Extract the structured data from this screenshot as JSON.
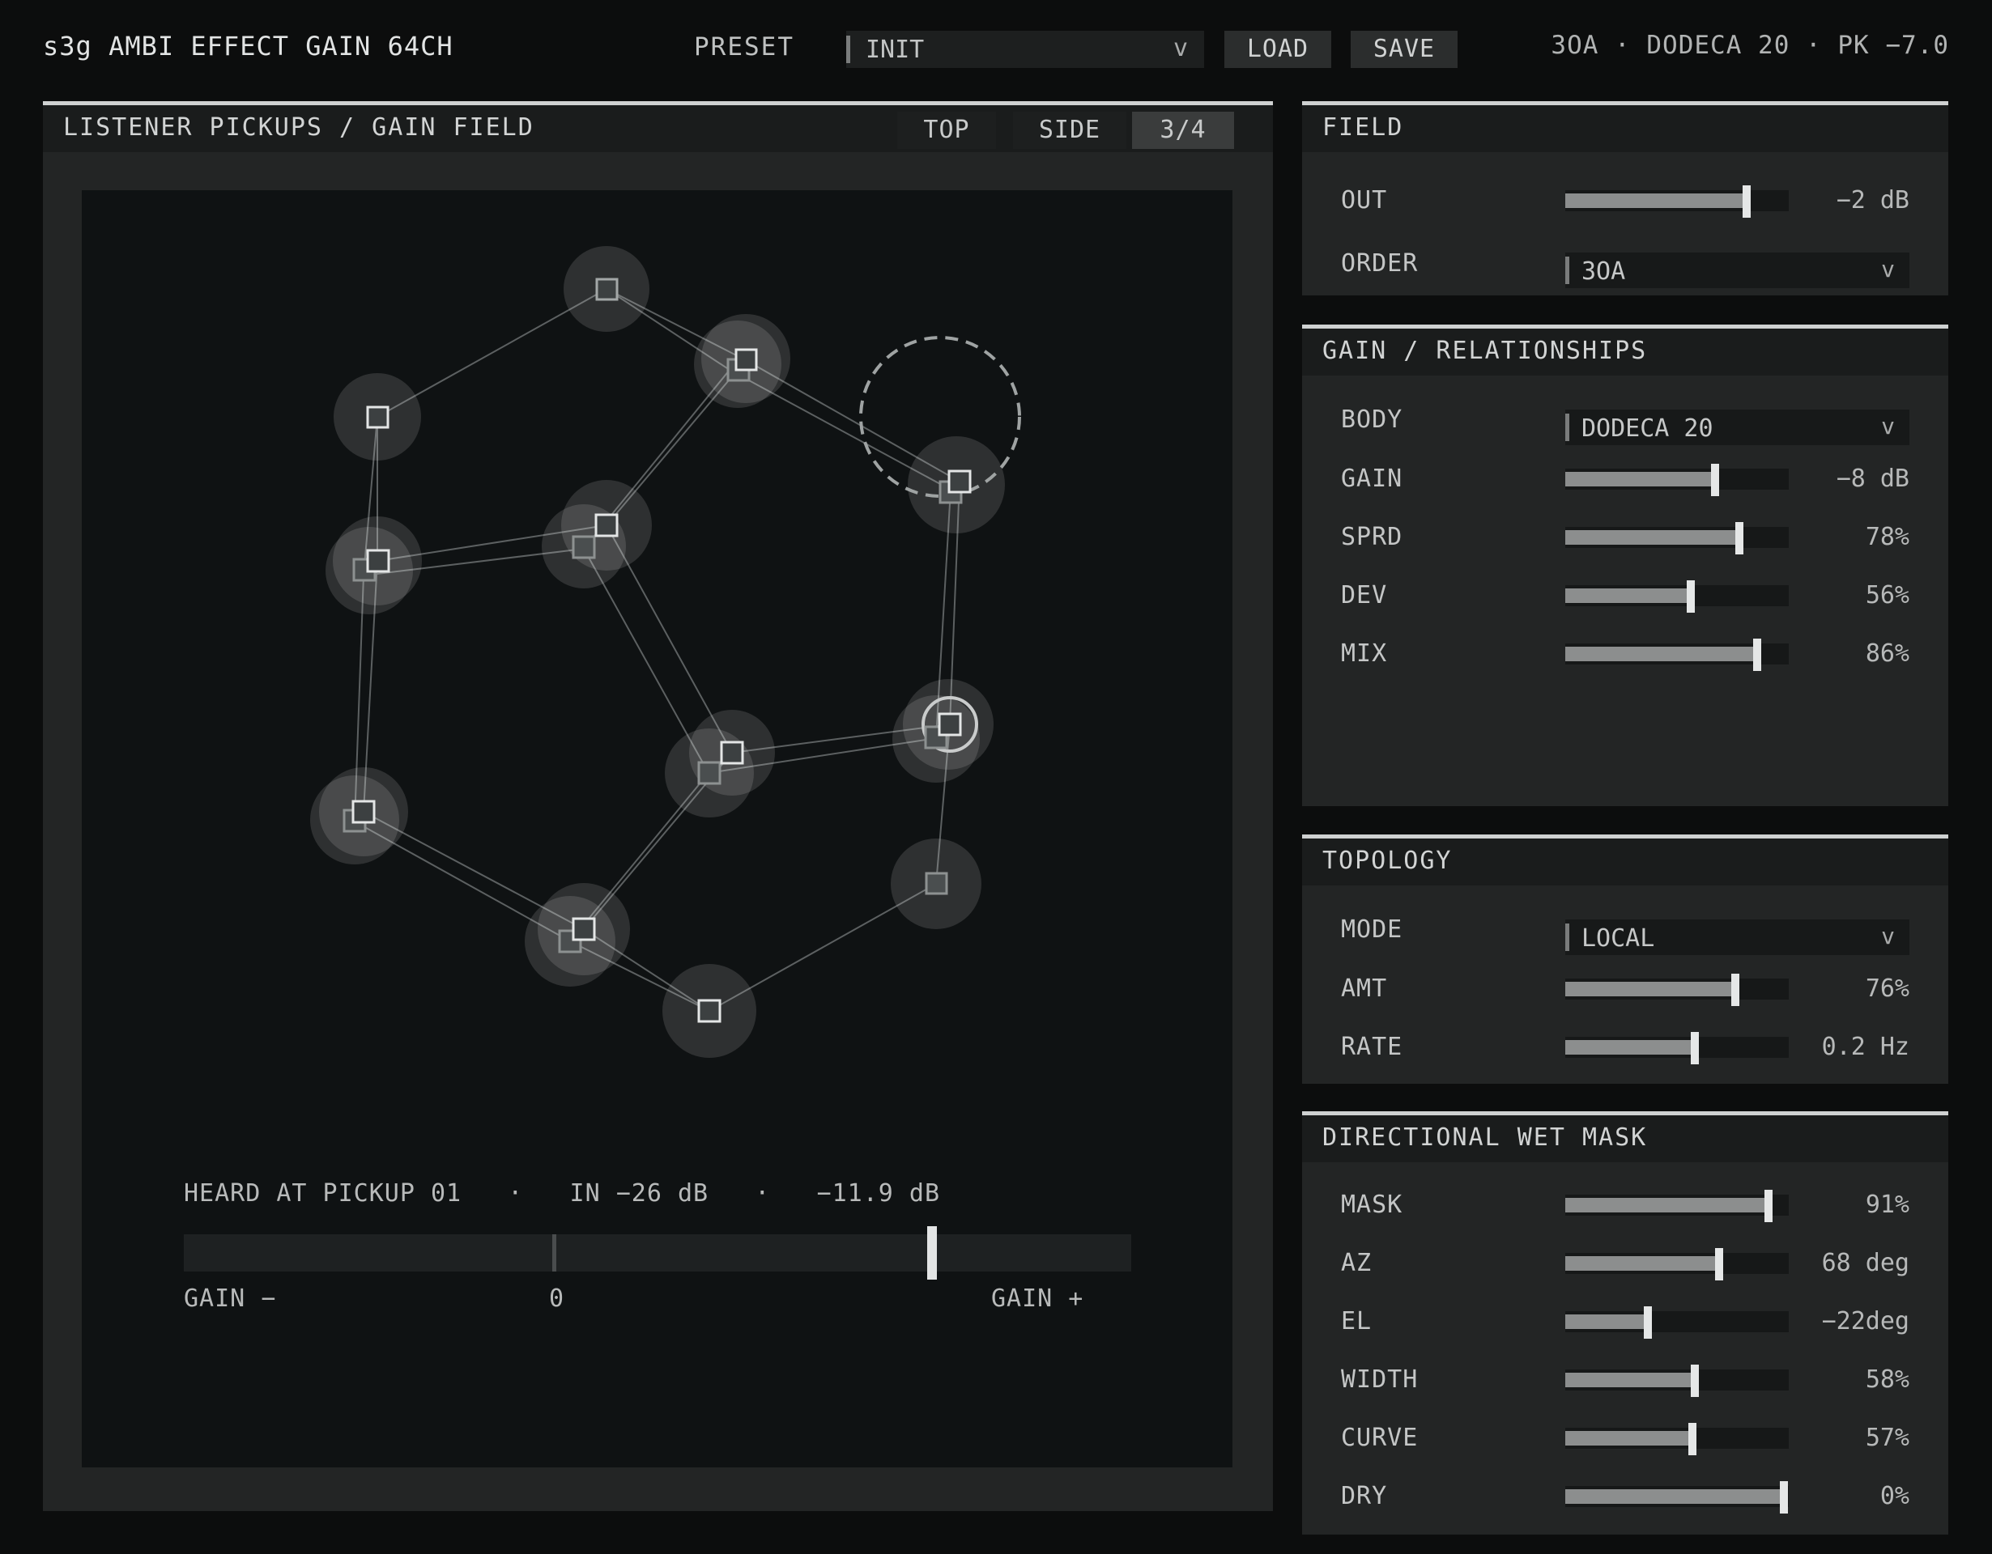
{
  "header": {
    "title": "s3g AMBI EFFECT GAIN 64CH",
    "preset_label": "PRESET",
    "preset_value": "INIT",
    "load_label": "LOAD",
    "save_label": "SAVE",
    "status": "3OA · DODECA 20 · PK −7.0"
  },
  "icons": {
    "dropdown_chevron": "v"
  },
  "field_panel": {
    "title": "LISTENER PICKUPS / GAIN FIELD",
    "tabs": [
      "TOP",
      "SIDE",
      "3/4"
    ],
    "active_tab": "3/4",
    "heard_readout": "HEARD AT PICKUP 01   ·   IN −26 dB   ·   −11.9 dB",
    "gain_meter": {
      "value_fraction": 0.79
    },
    "gain_minus_label": "GAIN −",
    "gain_zero_label": "0",
    "gain_plus_label": "GAIN +"
  },
  "panels": {
    "field": {
      "title": "FIELD",
      "out": {
        "label": "OUT",
        "value": "−2 dB",
        "fraction": 0.81
      },
      "order": {
        "label": "ORDER",
        "value": "3OA"
      }
    },
    "gain_rel": {
      "title": "GAIN / RELATIONSHIPS",
      "body": {
        "label": "BODY",
        "value": "DODECA 20"
      },
      "rows": [
        {
          "label": "GAIN",
          "value": "−8 dB",
          "fraction": 0.67
        },
        {
          "label": "SPRD",
          "value": "78%",
          "fraction": 0.78
        },
        {
          "label": "DEV",
          "value": "56%",
          "fraction": 0.56
        },
        {
          "label": "MIX",
          "value": "86%",
          "fraction": 0.86
        }
      ]
    },
    "topology": {
      "title": "TOPOLOGY",
      "mode": {
        "label": "MODE",
        "value": "LOCAL"
      },
      "rows": [
        {
          "label": "AMT",
          "value": "76%",
          "fraction": 0.76
        },
        {
          "label": "RATE",
          "value": "0.2 Hz",
          "fraction": 0.58
        }
      ]
    },
    "wet_mask": {
      "title": "DIRECTIONAL WET MASK",
      "rows": [
        {
          "label": "MASK",
          "value": "91%",
          "fraction": 0.91
        },
        {
          "label": "AZ",
          "value": "68 deg",
          "fraction": 0.69
        },
        {
          "label": "EL",
          "value": "−22deg",
          "fraction": 0.37
        },
        {
          "label": "WIDTH",
          "value": "58%",
          "fraction": 0.58
        },
        {
          "label": "CURVE",
          "value": "57%",
          "fraction": 0.57
        },
        {
          "label": "DRY",
          "value": "0%",
          "fraction": 0.98
        }
      ]
    }
  }
}
